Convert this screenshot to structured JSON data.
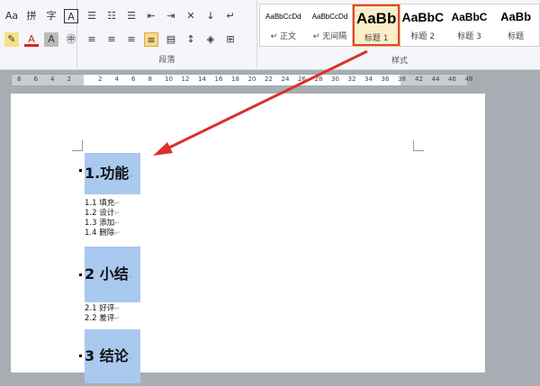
{
  "font_group": {
    "font_size_btn": "Aa",
    "phonetic": "拼",
    "char_border": "A",
    "char_shading": "A",
    "enclosed": "字",
    "font_color": "A"
  },
  "paragraph_group": {
    "label": "段落"
  },
  "styles_group": {
    "label": "样式",
    "items": [
      {
        "preview": "AaBbCcDd",
        "name": "↵ 正文"
      },
      {
        "preview": "AaBbCcDd",
        "name": "↵ 无间隔"
      },
      {
        "preview": "AaBb",
        "name": "标题 1",
        "selected": true
      },
      {
        "preview": "AaBbC",
        "name": "标题 2"
      },
      {
        "preview": "AaBbC",
        "name": "标题 3"
      },
      {
        "preview": "AaBb",
        "name": "标题"
      }
    ]
  },
  "ruler": {
    "left": [
      "8",
      "6",
      "4",
      "2"
    ],
    "right": [
      "2",
      "4",
      "6",
      "8",
      "10",
      "12",
      "14",
      "16",
      "18",
      "20",
      "22",
      "24",
      "26",
      "28",
      "30",
      "32",
      "34",
      "36",
      "38"
    ],
    "margin": [
      "42",
      "44",
      "46",
      "48"
    ]
  },
  "document": {
    "h1": "1.功能",
    "subs1": [
      "1.1 填充",
      "1.2 设计",
      "1.3 添加",
      "1.4 删除"
    ],
    "h2": "2 小结",
    "subs2": [
      "2.1 好评",
      "2.2 差评"
    ],
    "h3": "3 结论",
    "para_mark": "↵"
  },
  "colors": {
    "arrow": "#d9312b",
    "heading_highlight": "#a9c9ef"
  }
}
